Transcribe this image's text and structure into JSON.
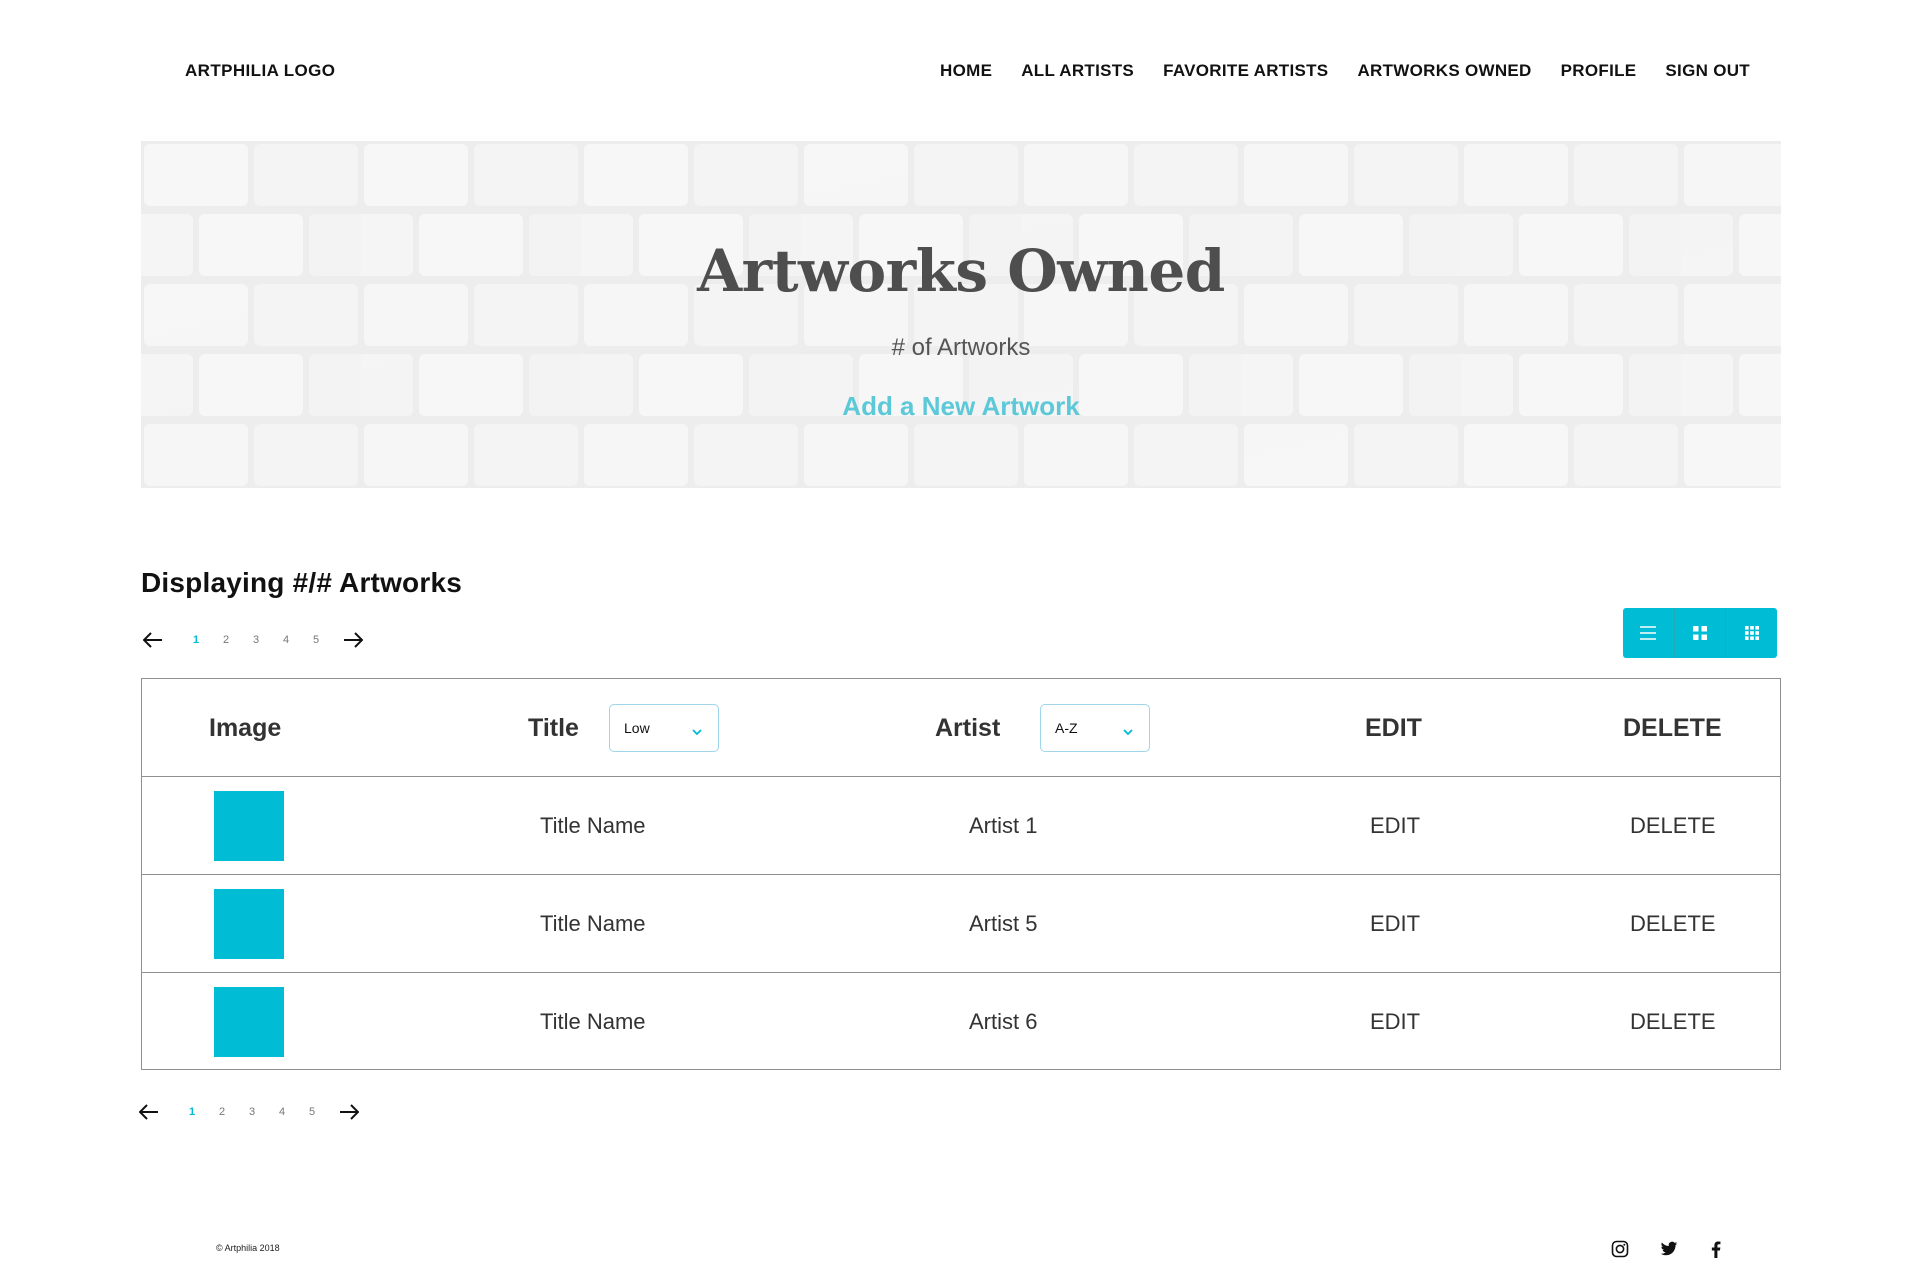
{
  "header": {
    "logo": "ARTPHILIA LOGO",
    "nav": [
      "HOME",
      "ALL ARTISTS",
      "FAVORITE ARTISTS",
      "ARTWORKS OWNED",
      "PROFILE",
      "SIGN OUT"
    ]
  },
  "hero": {
    "title": "Artworks Owned",
    "subtitle": "# of Artworks",
    "cta": "Add a New Artwork"
  },
  "listing": {
    "heading": "Displaying #/# Artworks",
    "pages": [
      "1",
      "2",
      "3",
      "4",
      "5"
    ],
    "active_page": "1"
  },
  "view_toggles": [
    "list-view-icon",
    "grid-view-icon",
    "small-grid-view-icon"
  ],
  "table": {
    "headers": {
      "image": "Image",
      "title": "Title",
      "title_sort": "Low",
      "artist": "Artist",
      "artist_sort": "A-Z",
      "edit": "EDIT",
      "delete": "DELETE"
    },
    "rows": [
      {
        "title": "Title Name",
        "artist": "Artist 1",
        "edit": "EDIT",
        "delete": "DELETE"
      },
      {
        "title": "Title Name",
        "artist": "Artist 5",
        "edit": "EDIT",
        "delete": "DELETE"
      },
      {
        "title": "Title Name",
        "artist": "Artist 6",
        "edit": "EDIT",
        "delete": "DELETE"
      }
    ]
  },
  "footer": {
    "copyright": "© Artphilia 2018",
    "social": [
      "instagram-icon",
      "twitter-icon",
      "facebook-icon"
    ]
  },
  "colors": {
    "accent": "#00bcd4",
    "link": "#5cc8d8",
    "text": "#1a1a1a"
  }
}
